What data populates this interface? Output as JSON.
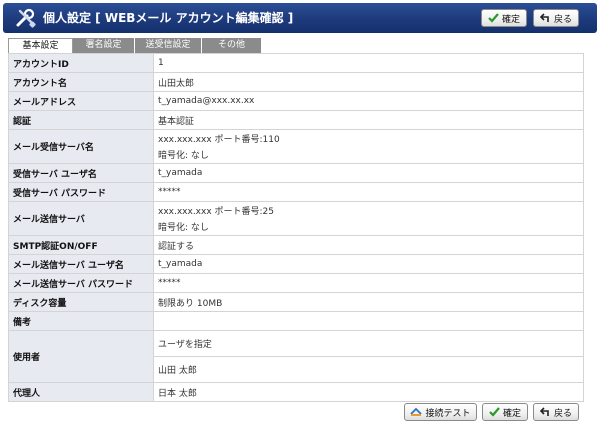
{
  "header": {
    "title": "個人設定 [ WEBメール  アカウント編集確認 ]",
    "confirm_label": "確定",
    "back_label": "戻る"
  },
  "tabs": [
    {
      "label": "基本設定",
      "active": true
    },
    {
      "label": "署名設定",
      "active": false
    },
    {
      "label": "送受信設定",
      "active": false
    },
    {
      "label": "その他",
      "active": false
    }
  ],
  "rows": {
    "account_id": {
      "label": "アカウントID",
      "value": "1"
    },
    "account_name": {
      "label": "アカウント名",
      "value": "山田太郎"
    },
    "mail_address": {
      "label": "メールアドレス",
      "value": "t_yamada@xxx.xx.xx"
    },
    "auth": {
      "label": "認証",
      "value": "基本認証"
    },
    "recv_server": {
      "label": "メール受信サーバ名",
      "value": "xxx.xxx.xxx  ポート番号:110",
      "value2": "暗号化: なし"
    },
    "recv_user": {
      "label": "受信サーバ ユーザ名",
      "value": "t_yamada"
    },
    "recv_pass": {
      "label": "受信サーバ パスワード",
      "value": "*****"
    },
    "send_server": {
      "label": "メール送信サーバ",
      "value": "xxx.xxx.xxx  ポート番号:25",
      "value2": "暗号化: なし"
    },
    "smtp_auth": {
      "label": "SMTP認証ON/OFF",
      "value": "認証する"
    },
    "send_user": {
      "label": "メール送信サーバ ユーザ名",
      "value": "t_yamada"
    },
    "send_pass": {
      "label": "メール送信サーバ パスワード",
      "value": "*****"
    },
    "disk": {
      "label": "ディスク容量",
      "value": "制限あり 10MB"
    },
    "note": {
      "label": "備考",
      "value": ""
    },
    "user": {
      "label": "使用者",
      "value": "ユーザを指定",
      "value2": "山田 太郎"
    },
    "proxy": {
      "label": "代理人",
      "value": "日本 太郎"
    }
  },
  "footer": {
    "test_label": "接続テスト",
    "confirm_label": "確定",
    "back_label": "戻る"
  },
  "colors": {
    "header_bg": "#1d3a7c",
    "label_bg": "#e7eaf0",
    "tab_inactive": "#8b8b8b",
    "check_green": "#2a9a2a"
  }
}
